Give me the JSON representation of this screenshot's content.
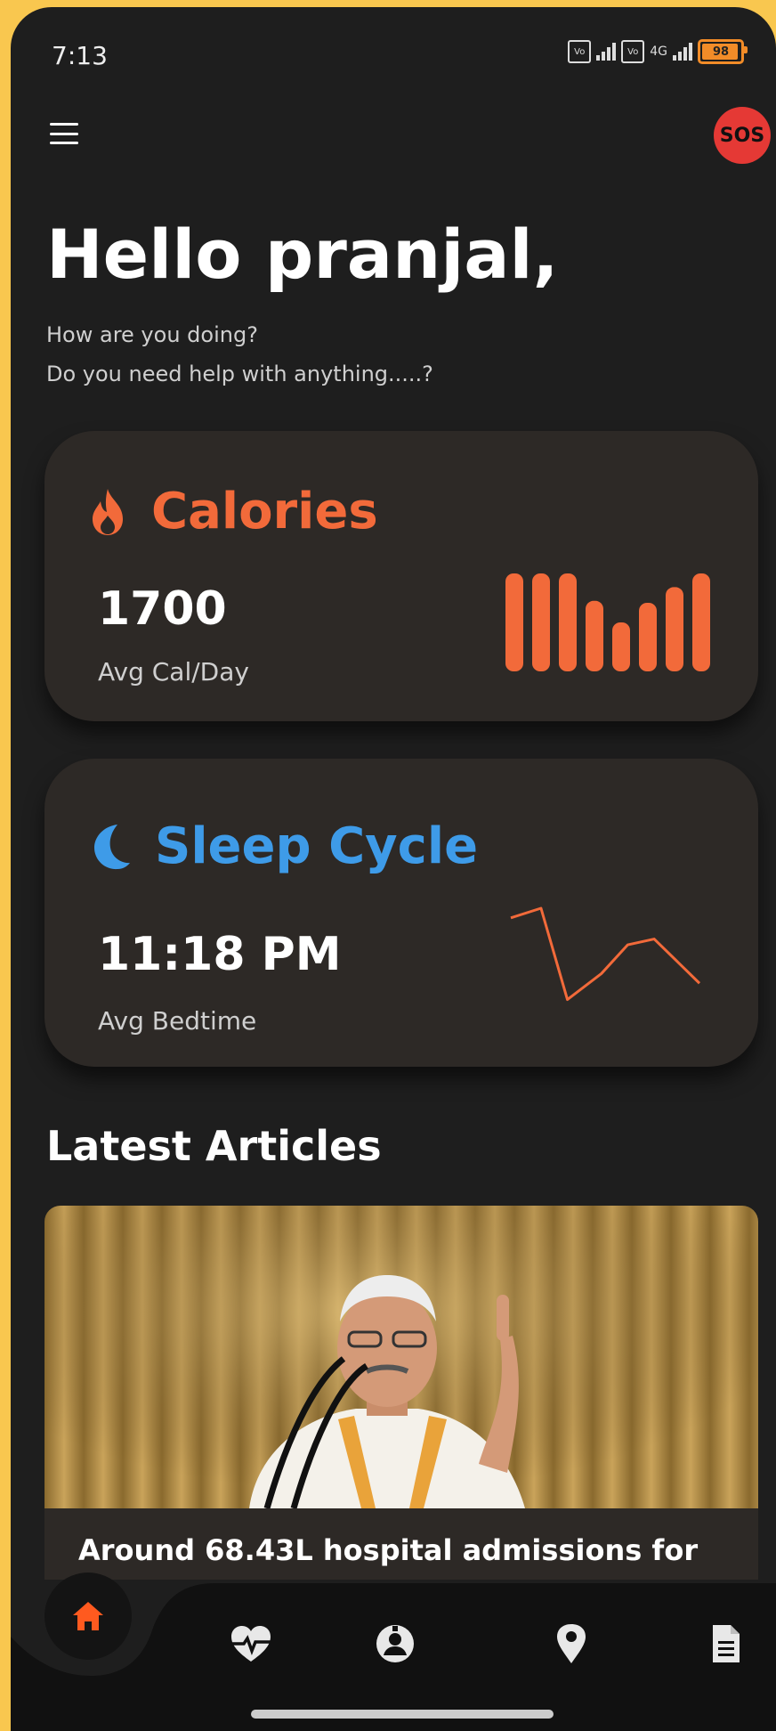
{
  "status_bar": {
    "time": "7:13",
    "network": "4G",
    "volte": "Vo",
    "battery": "98"
  },
  "header": {
    "sos_label": "SOS"
  },
  "greeting": {
    "title": "Hello pranjal,",
    "line1": "How are you doing?",
    "line2": "Do you need help with anything.....?"
  },
  "calories_card": {
    "title": "Calories",
    "value": "1700",
    "label": "Avg Cal/Day",
    "accent": "#F26A3A",
    "bar_levels": [
      1.0,
      1.0,
      1.0,
      0.72,
      0.5,
      0.7,
      0.86,
      1.0
    ]
  },
  "sleep_card": {
    "title": "Sleep Cycle",
    "value": "11:18 PM",
    "label": "Avg Bedtime",
    "accent": "#3E9BE8",
    "trend_color": "#F26A3A",
    "trend_levels": [
      0.9,
      1.0,
      0.05,
      0.32,
      0.62,
      0.68,
      0.22
    ]
  },
  "articles": {
    "heading": "Latest Articles",
    "items": [
      {
        "title": "Around 68.43L hospital admissions for"
      }
    ]
  },
  "nav": {
    "items": [
      "home-icon",
      "heart-pulse-icon",
      "doctor-icon",
      "location-pin-icon",
      "document-icon"
    ],
    "active_color": "#FF5A1F"
  },
  "colors": {
    "background": "#1E1E1E",
    "card": "#2D2926",
    "frame": "#F9C74F",
    "sos": "#E53935"
  }
}
